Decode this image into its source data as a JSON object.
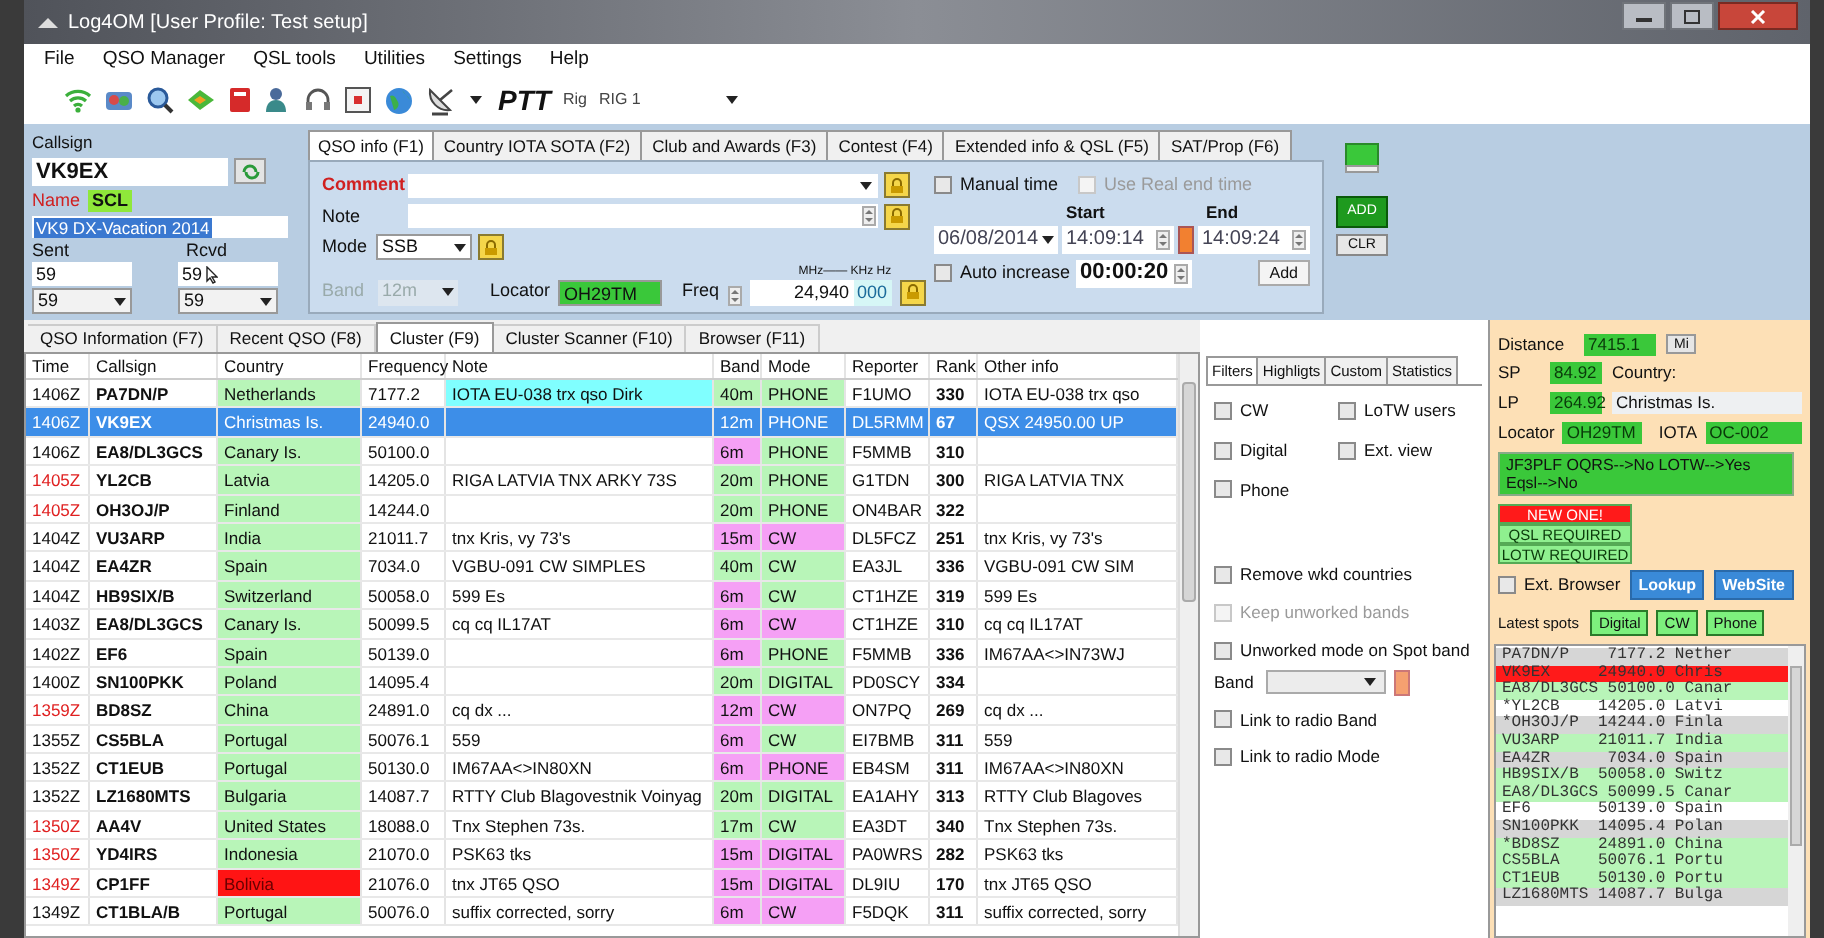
{
  "window": {
    "title": "Log4OM [User Profile: Test setup]"
  },
  "menu": [
    "File",
    "QSO Manager",
    "QSL tools",
    "Utilities",
    "Settings",
    "Help"
  ],
  "toolbar": {
    "ptt": "PTT",
    "rig_label": "Rig",
    "rig": "RIG 1"
  },
  "entry": {
    "callsign_label": "Callsign",
    "callsign": "VK9EX",
    "name_label": "Name",
    "name": "SCL",
    "comment_text": "VK9 DX-Vacation 2014",
    "sent_label": "Sent",
    "rcvd_label": "Rcvd",
    "sent": "59",
    "rcvd": "59",
    "sent_choice": "59",
    "rcvd_choice": "59"
  },
  "qso_tabs": [
    {
      "label": "QSO info (F1)",
      "selected": true
    },
    {
      "label": "Country IOTA SOTA (F2)",
      "selected": false
    },
    {
      "label": "Club and Awards (F3)",
      "selected": false
    },
    {
      "label": "Contest (F4)",
      "selected": false
    },
    {
      "label": "Extended info & QSL (F5)",
      "selected": false
    },
    {
      "label": "SAT/Prop (F6)",
      "selected": false
    }
  ],
  "qso_info": {
    "comment_label": "Comment",
    "note_label": "Note",
    "mode_label": "Mode",
    "mode": "SSB",
    "band_label": "Band",
    "band": "12m",
    "band_disabled": true,
    "locator_label": "Locator",
    "locator": "OH29TM",
    "freq_label": "Freq",
    "freq_units": "MHz—— KHz Hz",
    "freq": "24,940",
    "freq_hz": "000",
    "time_options": [
      {
        "label": "Manual time",
        "checked": false,
        "disabled": false
      },
      {
        "label": "Use Real end time",
        "checked": false,
        "disabled": true
      }
    ],
    "start_label": "Start",
    "end_label": "End",
    "date": "06/08/2014",
    "start": "14:09:14",
    "end": "14:09:24",
    "auto_increase": {
      "label": "Auto increase",
      "checked": false,
      "disabled": false
    },
    "increase": "00:00:20",
    "add_button": "Add"
  },
  "actions": [
    "ADD",
    "CLR"
  ],
  "lower_tabs": [
    {
      "label": "QSO Information (F7)",
      "selected": false
    },
    {
      "label": "Recent QSO (F8)",
      "selected": false
    },
    {
      "label": "Cluster (F9)",
      "selected": true
    },
    {
      "label": "Cluster Scanner (F10)",
      "selected": false
    },
    {
      "label": "Browser (F11)",
      "selected": false
    }
  ],
  "table": {
    "columns": [
      "Time",
      "Callsign",
      "Country",
      "Frequency",
      "Note",
      "Band",
      "Mode",
      "Reporter",
      "Rank",
      "Other info"
    ],
    "rows": [
      {
        "time": "1406Z",
        "time_alert": false,
        "callsign": "PA7DN/P",
        "country": "Netherlands",
        "new_country": false,
        "frequency": "7177.2",
        "note": "IOTA EU-038 trx qso Dirk",
        "note_highlight": true,
        "band": {
          "text": "40m",
          "color": "#b8f5b8"
        },
        "mode": {
          "text": "PHONE",
          "color": "#b8f5b8"
        },
        "reporter": "F1UMO",
        "rank": "330",
        "other_info": "IOTA EU-038 trx qso",
        "selected": false
      },
      {
        "time": "1406Z",
        "time_alert": false,
        "callsign": "VK9EX",
        "country": "Christmas Is.",
        "new_country": false,
        "frequency": "24940.0",
        "note": "",
        "note_highlight": false,
        "band": {
          "text": "12m"
        },
        "mode": {
          "text": "PHONE"
        },
        "reporter": "DL5RMM",
        "rank": "67",
        "other_info": "QSX 24950.00  UP",
        "selected": true
      },
      {
        "time": "1406Z",
        "time_alert": false,
        "callsign": "EA8/DL3GCS",
        "country": "Canary Is.",
        "new_country": false,
        "frequency": "50100.0",
        "note": "",
        "note_highlight": false,
        "band": {
          "text": "6m",
          "color": "#f5a0f5"
        },
        "mode": {
          "text": "PHONE",
          "color": "#b8f5b8"
        },
        "reporter": "F5MMB",
        "rank": "310",
        "other_info": "",
        "selected": false
      },
      {
        "time": "1405Z",
        "time_alert": true,
        "callsign": "YL2CB",
        "country": "Latvia",
        "new_country": false,
        "frequency": "14205.0",
        "note": "RIGA LATVIA TNX ARKY 73S",
        "note_highlight": false,
        "band": {
          "text": "20m",
          "color": "#b8f5b8"
        },
        "mode": {
          "text": "PHONE",
          "color": "#b8f5b8"
        },
        "reporter": "G1TDN",
        "rank": "300",
        "other_info": "RIGA LATVIA TNX",
        "selected": false
      },
      {
        "time": "1405Z",
        "time_alert": true,
        "callsign": "OH3OJ/P",
        "country": "Finland",
        "new_country": false,
        "frequency": "14244.0",
        "note": "",
        "note_highlight": false,
        "band": {
          "text": "20m",
          "color": "#b8f5b8"
        },
        "mode": {
          "text": "PHONE",
          "color": "#b8f5b8"
        },
        "reporter": "ON4BAR",
        "rank": "322",
        "other_info": "",
        "selected": false
      },
      {
        "time": "1404Z",
        "time_alert": false,
        "callsign": "VU3ARP",
        "country": "India",
        "new_country": false,
        "frequency": "21011.7",
        "note": "tnx Kris, vy 73's",
        "note_highlight": false,
        "band": {
          "text": "15m",
          "color": "#f5a0f5"
        },
        "mode": {
          "text": "CW",
          "color": "#f5a0f5"
        },
        "reporter": "DL5FCZ",
        "rank": "251",
        "other_info": "tnx Kris, vy 73's",
        "selected": false
      },
      {
        "time": "1404Z",
        "time_alert": false,
        "callsign": "EA4ZR",
        "country": "Spain",
        "new_country": false,
        "frequency": "7034.0",
        "note": "VGBU-091 CW SIMPLES",
        "note_highlight": false,
        "band": {
          "text": "40m",
          "color": "#b8f5b8"
        },
        "mode": {
          "text": "CW",
          "color": "#b8f5b8"
        },
        "reporter": "EA3JL",
        "rank": "336",
        "other_info": "VGBU-091 CW SIM",
        "selected": false
      },
      {
        "time": "1404Z",
        "time_alert": false,
        "callsign": "HB9SIX/B",
        "country": "Switzerland",
        "new_country": false,
        "frequency": "50058.0",
        "note": "599 Es",
        "note_highlight": false,
        "band": {
          "text": "6m",
          "color": "#f5a0f5"
        },
        "mode": {
          "text": "CW",
          "color": "#b8f5b8"
        },
        "reporter": "CT1HZE",
        "rank": "319",
        "other_info": "599 Es",
        "selected": false
      },
      {
        "time": "1403Z",
        "time_alert": false,
        "callsign": "EA8/DL3GCS",
        "country": "Canary Is.",
        "new_country": false,
        "frequency": "50099.5",
        "note": "cq cq IL17AT",
        "note_highlight": false,
        "band": {
          "text": "6m",
          "color": "#f5a0f5"
        },
        "mode": {
          "text": "CW",
          "color": "#f5a0f5"
        },
        "reporter": "CT1HZE",
        "rank": "310",
        "other_info": "cq cq IL17AT",
        "selected": false
      },
      {
        "time": "1402Z",
        "time_alert": false,
        "callsign": "EF6",
        "country": "Spain",
        "new_country": false,
        "frequency": "50139.0",
        "note": "",
        "note_highlight": false,
        "band": {
          "text": "6m",
          "color": "#f5a0f5"
        },
        "mode": {
          "text": "PHONE",
          "color": "#b8f5b8"
        },
        "reporter": "F5MMB",
        "rank": "336",
        "other_info": "IM67AA<>IN73WJ",
        "selected": false
      },
      {
        "time": "1400Z",
        "time_alert": false,
        "callsign": "SN100PKK",
        "country": "Poland",
        "new_country": false,
        "frequency": "14095.4",
        "note": "",
        "note_highlight": false,
        "band": {
          "text": "20m",
          "color": "#b8f5b8"
        },
        "mode": {
          "text": "DIGITAL",
          "color": "#b8f5b8"
        },
        "reporter": "PD0SCY",
        "rank": "334",
        "other_info": "",
        "selected": false
      },
      {
        "time": "1359Z",
        "time_alert": true,
        "callsign": "BD8SZ",
        "country": "China",
        "new_country": false,
        "frequency": "24891.0",
        "note": "cq dx ...",
        "note_highlight": false,
        "band": {
          "text": "12m",
          "color": "#f5a0f5"
        },
        "mode": {
          "text": "CW",
          "color": "#f5a0f5"
        },
        "reporter": "ON7PQ",
        "rank": "269",
        "other_info": "cq dx ...",
        "selected": false
      },
      {
        "time": "1355Z",
        "time_alert": false,
        "callsign": "CS5BLA",
        "country": "Portugal",
        "new_country": false,
        "frequency": "50076.1",
        "note": "559",
        "note_highlight": false,
        "band": {
          "text": "6m",
          "color": "#f5a0f5"
        },
        "mode": {
          "text": "CW",
          "color": "#b8f5b8"
        },
        "reporter": "EI7BMB",
        "rank": "311",
        "other_info": "559",
        "selected": false
      },
      {
        "time": "1352Z",
        "time_alert": false,
        "callsign": "CT1EUB",
        "country": "Portugal",
        "new_country": false,
        "frequency": "50130.0",
        "note": "IM67AA<>IN80XN",
        "note_highlight": false,
        "band": {
          "text": "6m",
          "color": "#f5a0f5"
        },
        "mode": {
          "text": "PHONE",
          "color": "#f5a0f5"
        },
        "reporter": "EB4SM",
        "rank": "311",
        "other_info": "IM67AA<>IN80XN",
        "selected": false
      },
      {
        "time": "1352Z",
        "time_alert": false,
        "callsign": "LZ1680MTS",
        "country": "Bulgaria",
        "new_country": false,
        "frequency": "14087.7",
        "note": "RTTY Club Blagovestnik Voinyag",
        "note_highlight": false,
        "band": {
          "text": "20m",
          "color": "#b8f5b8"
        },
        "mode": {
          "text": "DIGITAL",
          "color": "#b8f5b8"
        },
        "reporter": "EA1AHY",
        "rank": "313",
        "other_info": "RTTY Club Blagoves",
        "selected": false
      },
      {
        "time": "1350Z",
        "time_alert": true,
        "callsign": "AA4V",
        "country": "United States",
        "new_country": false,
        "frequency": "18088.0",
        "note": "Tnx Stephen 73s.",
        "note_highlight": false,
        "band": {
          "text": "17m",
          "color": "#b8f5b8"
        },
        "mode": {
          "text": "CW",
          "color": "#b8f5b8"
        },
        "reporter": "EA3DT",
        "rank": "340",
        "other_info": "Tnx Stephen 73s.",
        "selected": false
      },
      {
        "time": "1350Z",
        "time_alert": true,
        "callsign": "YD4IRS",
        "country": "Indonesia",
        "new_country": false,
        "frequency": "21070.0",
        "note": "PSK63 tks",
        "note_highlight": false,
        "band": {
          "text": "15m",
          "color": "#f5a0f5"
        },
        "mode": {
          "text": "DIGITAL",
          "color": "#f5a0f5"
        },
        "reporter": "PA0WRS",
        "rank": "282",
        "other_info": "PSK63 tks",
        "selected": false
      },
      {
        "time": "1349Z",
        "time_alert": true,
        "callsign": "CP1FF",
        "country": "Bolivia",
        "new_country": true,
        "frequency": "21076.0",
        "note": "tnx JT65 QSO",
        "note_highlight": false,
        "band": {
          "text": "15m",
          "color": "#f5a0f5"
        },
        "mode": {
          "text": "DIGITAL",
          "color": "#f5a0f5"
        },
        "reporter": "DL9IU",
        "rank": "170",
        "other_info": "tnx JT65 QSO",
        "selected": false
      },
      {
        "time": "1349Z",
        "time_alert": false,
        "callsign": "CT1BLA/B",
        "country": "Portugal",
        "new_country": false,
        "frequency": "50076.0",
        "note": "suffix corrected, sorry",
        "note_highlight": false,
        "band": {
          "text": "6m",
          "color": "#f5a0f5"
        },
        "mode": {
          "text": "CW",
          "color": "#f5a0f5"
        },
        "reporter": "F5DQK",
        "rank": "311",
        "other_info": "suffix corrected, sorry",
        "selected": false
      }
    ]
  },
  "filters": {
    "tabs": [
      {
        "label": "Filters",
        "selected": true
      },
      {
        "label": "Highligts",
        "selected": false
      },
      {
        "label": "Custom",
        "selected": false
      },
      {
        "label": "Statistics",
        "selected": false
      }
    ],
    "options_top": [
      {
        "label": "CW",
        "checked": false,
        "disabled": false
      },
      {
        "label": "LoTW users",
        "checked": false,
        "disabled": false
      },
      {
        "label": "Digital",
        "checked": false,
        "disabled": false
      },
      {
        "label": "Ext. view",
        "checked": false,
        "disabled": false
      },
      {
        "label": "Phone",
        "checked": false,
        "disabled": false
      }
    ],
    "options_middle": [
      {
        "label": "Remove wkd countries",
        "checked": false,
        "disabled": false
      },
      {
        "label": "Keep unworked bands",
        "checked": false,
        "disabled": true
      },
      {
        "label": "Unworked mode on Spot band",
        "checked": false,
        "disabled": false
      }
    ],
    "band_label": "Band",
    "options_bottom": [
      {
        "label": "Link to radio Band",
        "checked": false,
        "disabled": false
      },
      {
        "label": "Link to radio Mode",
        "checked": false,
        "disabled": false
      }
    ]
  },
  "info": {
    "distance_label": "Distance",
    "distance": "7415.1",
    "unit": "Mi",
    "sp_label": "SP",
    "sp": "84.92",
    "country_label": "Country:",
    "lp_label": "LP",
    "lp": "264.92",
    "country": "Christmas Is.",
    "locator_label": "Locator",
    "locator": "OH29TM",
    "iota_label": "IOTA",
    "iota": "OC-002",
    "qsl_info": "JF3PLF OQRS-->No LOTW-->Yes Eqsl-->No",
    "alerts": [
      {
        "text": "NEW ONE!",
        "kind": "new"
      },
      {
        "text": "QSL REQUIRED",
        "kind": "required"
      },
      {
        "text": "LOTW REQUIRED",
        "kind": "required"
      }
    ],
    "ext_browser": {
      "label": "Ext. Browser",
      "checked": false,
      "disabled": false
    },
    "buttons": [
      "Lookup",
      "WebSite"
    ],
    "spots_label": "Latest spots",
    "spot_filters": [
      "Digital",
      "CW",
      "Phone"
    ]
  },
  "spots": [
    {
      "text": "PA7DN/P    7177.2 Nether",
      "color": "#d6d6d6"
    },
    {
      "text": "VK9EX     24940.0 Chris",
      "color": "#ff1a1a"
    },
    {
      "text": "EA8/DL3GCS 50100.0 Canar",
      "color": "#b8f5b8"
    },
    {
      "text": "*YL2CB    14205.0 Latvi",
      "color": "#ffffff"
    },
    {
      "text": "*OH3OJ/P  14244.0 Finla",
      "color": "#d6d6d6"
    },
    {
      "text": "VU3ARP    21011.7 India",
      "color": "#b8f5b8"
    },
    {
      "text": "EA4ZR      7034.0 Spain",
      "color": "#d6d6d6"
    },
    {
      "text": "HB9SIX/B  50058.0 Switz",
      "color": "#b8f5b8"
    },
    {
      "text": "EA8/DL3GCS 50099.5 Canar",
      "color": "#b8f5b8"
    },
    {
      "text": "EF6       50139.0 Spain",
      "color": "#ffffff"
    },
    {
      "text": "SN100PKK  14095.4 Polan",
      "color": "#d6d6d6"
    },
    {
      "text": "*BD8SZ    24891.0 China",
      "color": "#b8f5b8"
    },
    {
      "text": "CS5BLA    50076.1 Portu",
      "color": "#b8f5b8"
    },
    {
      "text": "CT1EUB    50130.0 Portu",
      "color": "#b8f5b8"
    },
    {
      "text": "LZ1680MTS 14087.7 Bulga",
      "color": "#d6d6d6"
    }
  ]
}
